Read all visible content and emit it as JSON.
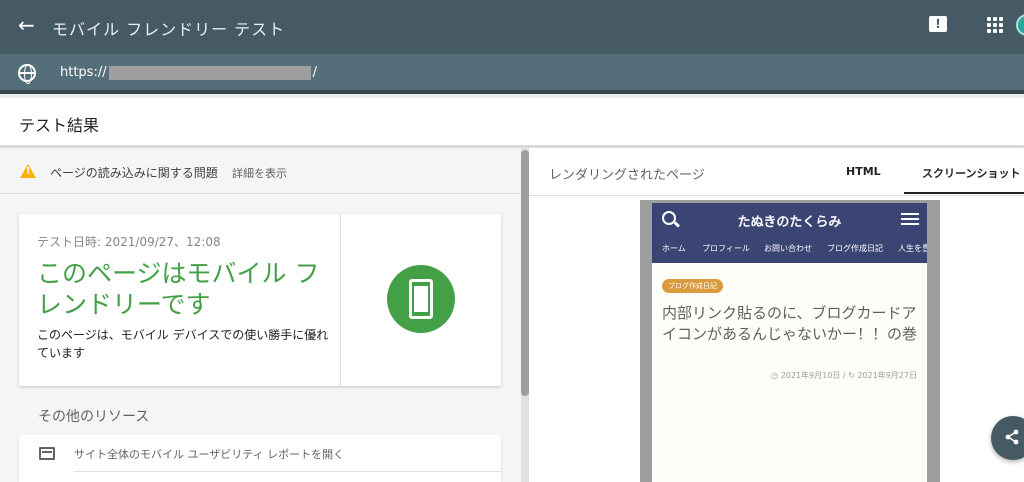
{
  "topbar": {
    "title": "モバイル フレンドリー テスト",
    "back_icon": "arrow-left-icon",
    "feedback_icon": "feedback-icon",
    "apps_icon": "apps-grid-icon"
  },
  "urlbar": {
    "prefix": "https://",
    "suffix": "/"
  },
  "results": {
    "title": "テスト結果"
  },
  "issues": {
    "label": "ページの読み込みに関する問題",
    "detail_link": "詳細を表示"
  },
  "result_card": {
    "date": "テスト日時: 2021/09/27、12:08",
    "headline": "このページはモバイル フレンドリーです",
    "description": "このページは、モバイル デバイスでの使い勝手に優れています",
    "accent": "#43a047"
  },
  "resources": {
    "title": "その他のリソース",
    "items": [
      {
        "label": "サイト全体のモバイル ユーザビリティ レポートを開く"
      }
    ]
  },
  "rendered": {
    "title": "レンダリングされたページ",
    "tabs": [
      {
        "label": "HTML"
      },
      {
        "label": "スクリーンショット"
      }
    ]
  },
  "preview": {
    "site_name": "たぬきのたくらみ",
    "nav": [
      "ホーム",
      "プロフィール",
      "お問い合わせ",
      "ブログ作成日記",
      "人生を豊"
    ],
    "category": "ブログ作成日記",
    "post_title": "内部リンク貼るのに、ブログカードアイコンがあるんじゃないかー！！の巻",
    "published": "2021年9月10日",
    "updated": "2021年9月27日",
    "header_color": "#3b4573"
  }
}
